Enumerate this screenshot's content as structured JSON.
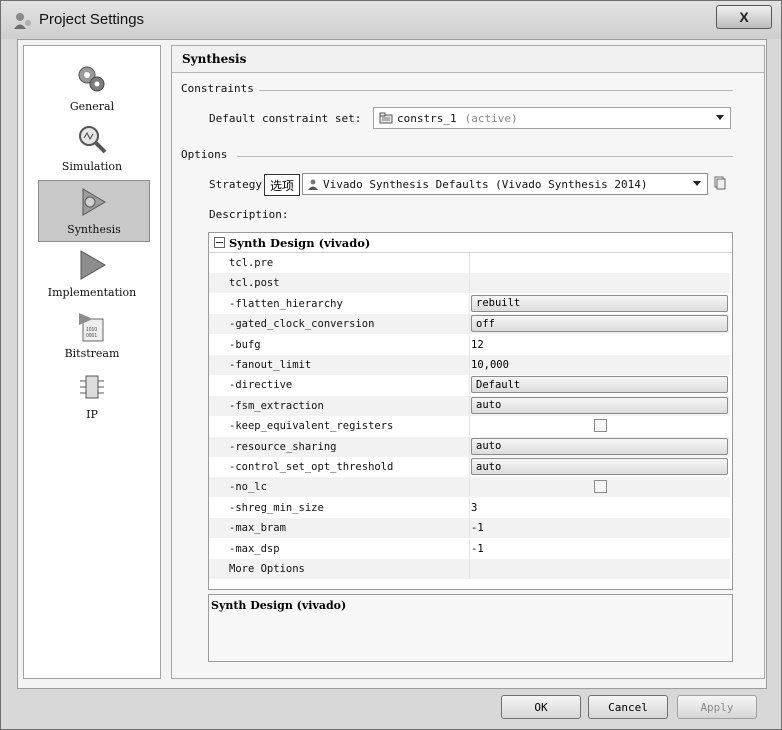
{
  "window": {
    "title": "Project Settings",
    "close_label": "X"
  },
  "sidebar": {
    "items": [
      {
        "label": "General",
        "icon": "general-icon",
        "selected": false
      },
      {
        "label": "Simulation",
        "icon": "magnifier-icon",
        "selected": false
      },
      {
        "label": "Synthesis",
        "icon": "synthesis-icon",
        "selected": true
      },
      {
        "label": "Implementation",
        "icon": "play-arrow-icon",
        "selected": false
      },
      {
        "label": "Bitstream",
        "icon": "bitstream-icon",
        "selected": false
      },
      {
        "label": "IP",
        "icon": "ip-chip-icon",
        "selected": false
      }
    ]
  },
  "panel": {
    "title": "Synthesis",
    "constraints_section": "Constraints",
    "default_constraint_label": "Default constraint set:",
    "constraint_set_value": "constrs_1",
    "constraint_set_status": "(active)",
    "options_section": "Options",
    "strategy_label": "Strategy",
    "strategy_tag": "选项",
    "strategy_value": "Vivado Synthesis Defaults (Vivado Synthesis 2014)",
    "description_label": "Description:"
  },
  "options_table": {
    "group_title": "Synth Design (vivado)",
    "rows": [
      {
        "name": "tcl.pre",
        "type": "text",
        "value": ""
      },
      {
        "name": "tcl.post",
        "type": "text",
        "value": ""
      },
      {
        "name": "-flatten_hierarchy",
        "type": "combo",
        "value": "rebuilt"
      },
      {
        "name": "-gated_clock_conversion",
        "type": "combo",
        "value": "off"
      },
      {
        "name": "-bufg",
        "type": "text",
        "value": "12"
      },
      {
        "name": "-fanout_limit",
        "type": "text",
        "value": "10,000"
      },
      {
        "name": "-directive",
        "type": "combo",
        "value": "Default"
      },
      {
        "name": "-fsm_extraction",
        "type": "combo",
        "value": "auto"
      },
      {
        "name": "-keep_equivalent_registers",
        "type": "checkbox",
        "value": ""
      },
      {
        "name": "-resource_sharing",
        "type": "combo",
        "value": "auto"
      },
      {
        "name": "-control_set_opt_threshold",
        "type": "combo",
        "value": "auto"
      },
      {
        "name": "-no_lc",
        "type": "checkbox",
        "value": ""
      },
      {
        "name": "-shreg_min_size",
        "type": "text",
        "value": "3"
      },
      {
        "name": "-max_bram",
        "type": "text",
        "value": "-1"
      },
      {
        "name": "-max_dsp",
        "type": "text",
        "value": "-1"
      },
      {
        "name": "More Options",
        "type": "text",
        "value": ""
      }
    ]
  },
  "description_box": {
    "text": "Synth Design (vivado)"
  },
  "footer": {
    "ok_label": "OK",
    "cancel_label": "Cancel",
    "apply_label": "Apply"
  }
}
